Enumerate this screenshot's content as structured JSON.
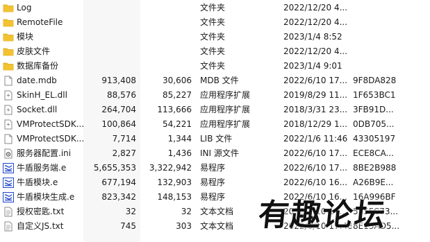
{
  "colors": {
    "folder": "#f2c230",
    "folder_dark": "#d9a515",
    "exe_blue": "#2a4fcf",
    "doc_border": "#8a8a8a"
  },
  "rows": [
    {
      "name": "Log",
      "icon": "folder-icon",
      "size1": "",
      "size2": "",
      "type": "文件夹",
      "date": "2022/12/20 4...",
      "crc": ""
    },
    {
      "name": "RemoteFile",
      "icon": "folder-icon",
      "size1": "",
      "size2": "",
      "type": "文件夹",
      "date": "2022/12/20 4...",
      "crc": ""
    },
    {
      "name": "模块",
      "icon": "folder-icon",
      "size1": "",
      "size2": "",
      "type": "文件夹",
      "date": "2023/1/4 8:52",
      "crc": ""
    },
    {
      "name": "皮肤文件",
      "icon": "folder-icon",
      "size1": "",
      "size2": "",
      "type": "文件夹",
      "date": "2022/12/20 4...",
      "crc": ""
    },
    {
      "name": "数据库备份",
      "icon": "folder-icon",
      "size1": "",
      "size2": "",
      "type": "文件夹",
      "date": "2023/1/4 9:01",
      "crc": ""
    },
    {
      "name": "date.mdb",
      "icon": "file-icon",
      "size1": "913,408",
      "size2": "30,606",
      "type": "MDB 文件",
      "date": "2022/6/10 17...",
      "crc": "9F8DA828"
    },
    {
      "name": "SkinH_EL.dll",
      "icon": "dll-icon",
      "size1": "88,576",
      "size2": "85,227",
      "type": "应用程序扩展",
      "date": "2019/8/29 11...",
      "crc": "1F653BC1"
    },
    {
      "name": "Socket.dll",
      "icon": "dll-icon",
      "size1": "264,704",
      "size2": "113,666",
      "type": "应用程序扩展",
      "date": "2018/3/31 23...",
      "crc": "3FB91D..."
    },
    {
      "name": "VMProtectSDK...",
      "icon": "dll-icon",
      "size1": "100,864",
      "size2": "54,221",
      "type": "应用程序扩展",
      "date": "2018/12/29 1...",
      "crc": "0DB705..."
    },
    {
      "name": "VMProtectSDK...",
      "icon": "file-icon",
      "size1": "7,714",
      "size2": "1,344",
      "type": "LIB 文件",
      "date": "2022/1/6 11:46",
      "crc": "43305197"
    },
    {
      "name": "服务器配置.ini",
      "icon": "ini-icon",
      "size1": "2,827",
      "size2": "1,436",
      "type": "INI 源文件",
      "date": "2022/6/10 17...",
      "crc": "ECE8CA..."
    },
    {
      "name": "牛盾服务端.e",
      "icon": "e-program-icon",
      "size1": "5,655,353",
      "size2": "3,322,942",
      "type": "易程序",
      "date": "2022/6/10 17...",
      "crc": "8BE2B988"
    },
    {
      "name": "牛盾模块.e",
      "icon": "e-program-icon",
      "size1": "677,194",
      "size2": "132,903",
      "type": "易程序",
      "date": "2022/6/10 16...",
      "crc": "A26B9E..."
    },
    {
      "name": "牛盾模块生成.e",
      "icon": "e-program-icon",
      "size1": "823,342",
      "size2": "148,153",
      "type": "易程序",
      "date": "2022/6/10 16...",
      "crc": "16A996BF"
    },
    {
      "name": "授权密匙.txt",
      "icon": "text-file-icon",
      "size1": "32",
      "size2": "32",
      "type": "文本文档",
      "date": "2022/6/10 14...",
      "crc": "555FC73..."
    },
    {
      "name": "自定义JS.txt",
      "icon": "text-file-icon",
      "size1": "745",
      "size2": "303",
      "type": "文本文档",
      "date": "2022/6/10 17:48",
      "crc": "8E13AD5..."
    }
  ],
  "watermark": {
    "text": "有趣论坛"
  }
}
